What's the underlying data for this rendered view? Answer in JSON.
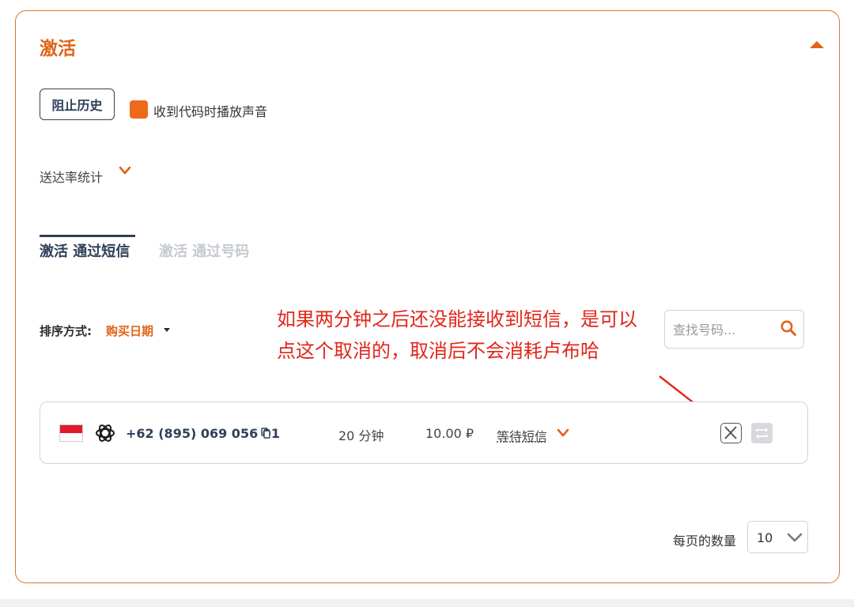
{
  "panel": {
    "title": "激活",
    "history_button": "阻止历史",
    "sound_option_label": "收到代码时播放声音",
    "sound_option_checked": true,
    "stats_label": "送达率统计"
  },
  "tabs": [
    {
      "label": "激活 通过短信",
      "active": true
    },
    {
      "label": "激活 通过号码",
      "active": false
    }
  ],
  "sort": {
    "label": "排序方式:",
    "value": "购买日期"
  },
  "search": {
    "placeholder": "查找号码..."
  },
  "annotation": {
    "text": "如果两分钟之后还没能接收到短信，是可以点这个取消的，取消后不会消耗卢布哈"
  },
  "activations": [
    {
      "country_flag": "flag-indonesia",
      "service_icon": "openai-icon",
      "phone": "+62 (895) 069 056 01",
      "duration": "20 分钟",
      "price": "10.00 ₽",
      "status": "等待短信"
    }
  ],
  "pagination": {
    "per_page_label": "每页的数量",
    "per_page_value": "10"
  },
  "colors": {
    "accent": "#e0641a",
    "navy": "#2f4158",
    "annotation_red": "#e1261b"
  }
}
